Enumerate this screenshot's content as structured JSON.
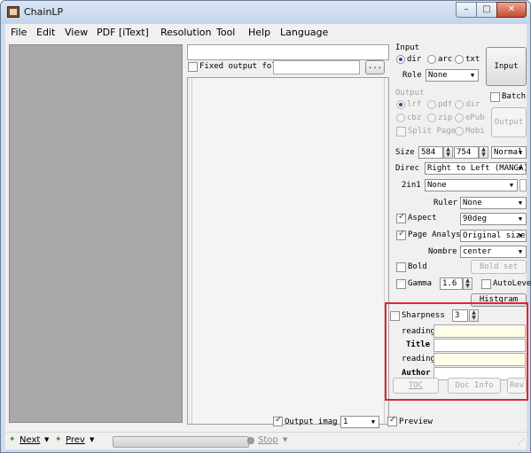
{
  "window": {
    "title": "ChainLP",
    "controls": {
      "minimize": "–",
      "maximize": "□",
      "close": "✕"
    }
  },
  "menu": [
    "File",
    "Edit",
    "View",
    "PDF [iText]",
    "Resolution",
    "Tool",
    "Help",
    "Language"
  ],
  "middle": {
    "fixed_output_label": "Fixed output folde",
    "browse_label": "...",
    "output_image_label": "Output imag",
    "output_image_value": "1",
    "preview_label": "Preview"
  },
  "input_group": {
    "title": "Input",
    "options": [
      "dir",
      "arc",
      "txt"
    ],
    "selected": "dir",
    "role_label": "Role",
    "role_value": "None",
    "button": "Input"
  },
  "output_group": {
    "title": "Output",
    "row1": [
      "lrf",
      "pdf",
      "dir"
    ],
    "row2": [
      "cbz",
      "zip",
      "ePub"
    ],
    "split_label": "Split Page",
    "mobi_label": "Mobi",
    "batch_label": "Batch",
    "button": "Output"
  },
  "settings": {
    "size_label": "Size",
    "width": "584",
    "height": "754",
    "size_mode": "Normal",
    "direc_label": "Direc",
    "direc_value": "Right to Left (MANGA)",
    "twoin1_label": "2in1",
    "twoin1_value": "None",
    "ruler_label": "Ruler",
    "ruler_value": "None",
    "aspect_label": "Aspect",
    "aspect_value": "90deg",
    "page_analys_label": "Page Analys",
    "page_analys_value": "Original size",
    "nombre_label": "Nombre",
    "nombre_value": "center",
    "bold_label": "Bold",
    "bold_set_label": "Bold set",
    "gamma_label": "Gamma",
    "gamma_value": "1.6",
    "autolevel_label": "AutoLevel",
    "histgram_label": "Histgram"
  },
  "highlight": {
    "sharpness_label": "Sharpness",
    "sharpness_value": "3",
    "reading1": "reading",
    "title_label": "Title",
    "reading2": "reading",
    "author_label": "Author",
    "toc_label": "TOC",
    "doc_info_label": "Doc Info",
    "rev_label": "Rev"
  },
  "status": {
    "next": "Next",
    "prev": "Prev",
    "stop": "Stop"
  },
  "colors": {
    "highlight_border": "#e5252e",
    "pane_gray": "#a9a9a9"
  }
}
